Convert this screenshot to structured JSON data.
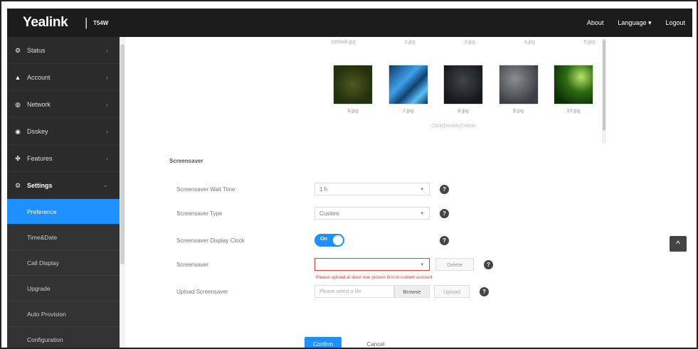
{
  "header": {
    "logo": "Yealink",
    "separator": "|",
    "model": "T54W",
    "nav": [
      "About",
      "Language ▾",
      "Logout"
    ]
  },
  "sidebar": {
    "items": [
      {
        "label": "Status",
        "icon": "status-icon",
        "glyph": "⚙"
      },
      {
        "label": "Account",
        "icon": "user-icon",
        "glyph": "👤"
      },
      {
        "label": "Network",
        "icon": "globe-icon",
        "glyph": "🌐"
      },
      {
        "label": "Dsskey",
        "icon": "dsskey-icon",
        "glyph": "◉"
      },
      {
        "label": "Features",
        "icon": "features-icon",
        "glyph": "⚘"
      },
      {
        "label": "Settings",
        "icon": "settings-icon",
        "glyph": "⚙"
      }
    ],
    "subitems": [
      "Preference",
      "Time&Date",
      "Call Display",
      "Upgrade",
      "Auto Provision",
      "Configuration"
    ],
    "active_subitem": 0
  },
  "gallery": {
    "top_captions": [
      "Default.jpg",
      "2.jpg",
      "3.jpg",
      "4.jpg",
      "5.jpg"
    ],
    "thumbnails": [
      {
        "caption": "6.jpg",
        "name": "wallpaper-thumb-6"
      },
      {
        "caption": "7.jpg",
        "name": "wallpaper-thumb-7"
      },
      {
        "caption": "8.jpg",
        "name": "wallpaper-thumb-8"
      },
      {
        "caption": "9.jpg",
        "name": "wallpaper-thumb-9"
      },
      {
        "caption": "10.jpg",
        "name": "wallpaper-thumb-10"
      }
    ],
    "footer": "Click(Double)Delete"
  },
  "screensaver": {
    "title": "Screensaver",
    "wait_time": {
      "label": "Screensaver Wait Time",
      "value": "1 h"
    },
    "type": {
      "label": "Screensaver Type",
      "value": "Custom"
    },
    "clock": {
      "label": "Screensaver Display Clock",
      "value": "On"
    },
    "screensaver": {
      "label": "Screensaver",
      "value": "",
      "delete_label": "Delete"
    },
    "error": "Please upload at least one picture first in current account",
    "upload": {
      "label": "Upload Screensaver",
      "placeholder": "Please select a file",
      "browse": "Browse",
      "upload": "Upload"
    }
  },
  "actions": {
    "confirm": "Confirm",
    "cancel": "Cancel"
  },
  "to_top_glyph": "^",
  "colors": {
    "accent": "#1e90ff",
    "error": "#e53935",
    "topbar": "#1c1c1c",
    "sidebar": "#2b2b2b"
  }
}
